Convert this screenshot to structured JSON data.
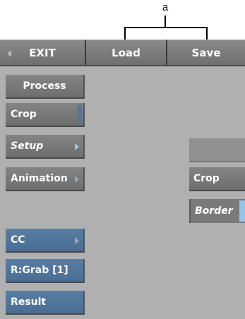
{
  "callout": {
    "letter": "a"
  },
  "topbar": {
    "exit_label": "EXIT",
    "load_label": "Load",
    "save_label": "Save"
  },
  "sidebar": {
    "process_label": "Process",
    "crop_label": "Crop",
    "setup_label": "Setup",
    "animation_label": "Animation",
    "cc_label": "CC",
    "grab_label": "R:Grab [1]",
    "result_label": "Result"
  },
  "right": {
    "crop_label": "Crop",
    "border_label": "Border",
    "border_color": "#8ec6ef"
  },
  "colors": {
    "panel": "#b0b0b0",
    "button_grey": "#7a7a7a",
    "button_blue": "#4f7399"
  }
}
